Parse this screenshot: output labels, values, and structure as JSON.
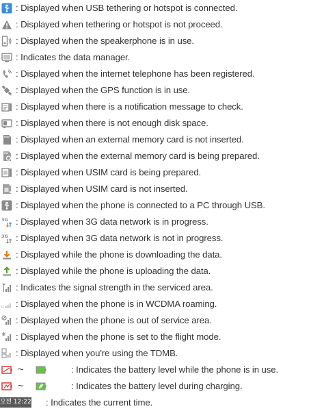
{
  "items": [
    {
      "icon": "usb-tethering-icon",
      "text": ": Displayed when USB tethering or hotspot is connected."
    },
    {
      "icon": "tethering-warning-icon",
      "text": ": Displayed when tethering or hotspot is not proceed."
    },
    {
      "icon": "speakerphone-icon",
      "text": ": Displayed when the speakerphone is in use."
    },
    {
      "icon": "data-manager-icon",
      "text": ": Indicates the data manager."
    },
    {
      "icon": "internet-telephone-icon",
      "text": ": Displayed when the internet telephone has been registered."
    },
    {
      "icon": "gps-icon",
      "text": ": Displayed when the GPS function is in use."
    },
    {
      "icon": "notification-message-icon",
      "text": ": Displayed when there is a notification message to check."
    },
    {
      "icon": "low-disk-space-icon",
      "text": ": Displayed when there is not enough disk space."
    },
    {
      "icon": "memory-card-missing-icon",
      "text": ": Displayed when an external memory card is not inserted."
    },
    {
      "icon": "memory-card-preparing-icon",
      "text": ": Displayed when the external memory card is being prepared."
    },
    {
      "icon": "usim-preparing-icon",
      "text": ": Displayed when USIM card is being prepared."
    },
    {
      "icon": "usim-missing-icon",
      "text": ": Displayed when USIM card is not inserted."
    },
    {
      "icon": "pc-usb-connection-icon",
      "text": ": Displayed when the phone is connected to a PC through USB."
    },
    {
      "icon": "3g-active-icon",
      "text": ": Displayed when 3G data network is in progress."
    },
    {
      "icon": "3g-inactive-icon",
      "text": ": Displayed when 3G data network is not in progress."
    },
    {
      "icon": "download-icon",
      "text": ": Displayed while the phone is downloading the data."
    },
    {
      "icon": "upload-icon",
      "text": ": Displayed while the phone is uploading the data."
    },
    {
      "icon": "signal-strength-icon",
      "text": ": Indicates the signal strength in the serviced area."
    },
    {
      "icon": "wcdma-roaming-icon",
      "text": ": Displayed when the phone is in WCDMA roaming."
    },
    {
      "icon": "no-service-icon",
      "text": ": Displayed when the phone is out of service area."
    },
    {
      "icon": "flight-mode-icon",
      "text": ": Displayed when the phone is set to the flight mode."
    },
    {
      "icon": "tdmb-icon",
      "text": ": Displayed when you're using the TDMB."
    }
  ],
  "battery_in_use": {
    "icons": [
      "battery-empty-icon",
      "battery-full-icon"
    ],
    "tilde": "~",
    "text": ": Indicates the battery level while the phone is in use."
  },
  "battery_charging": {
    "icons": [
      "battery-charging-empty-icon",
      "battery-charging-full-icon"
    ],
    "tilde": "~",
    "text": ": Indicates the battery level during charging."
  },
  "current_time": {
    "badge": "오전 12:22",
    "text": ": Indicates the current time."
  },
  "colors": {
    "text": "#333333",
    "icon_blue": "#3a8fd6",
    "icon_gray": "#8a8a8a",
    "battery_red": "#d83a3a",
    "battery_green": "#6cc04a",
    "download_orange": "#e07a1a",
    "upload_green": "#5aa02a"
  }
}
